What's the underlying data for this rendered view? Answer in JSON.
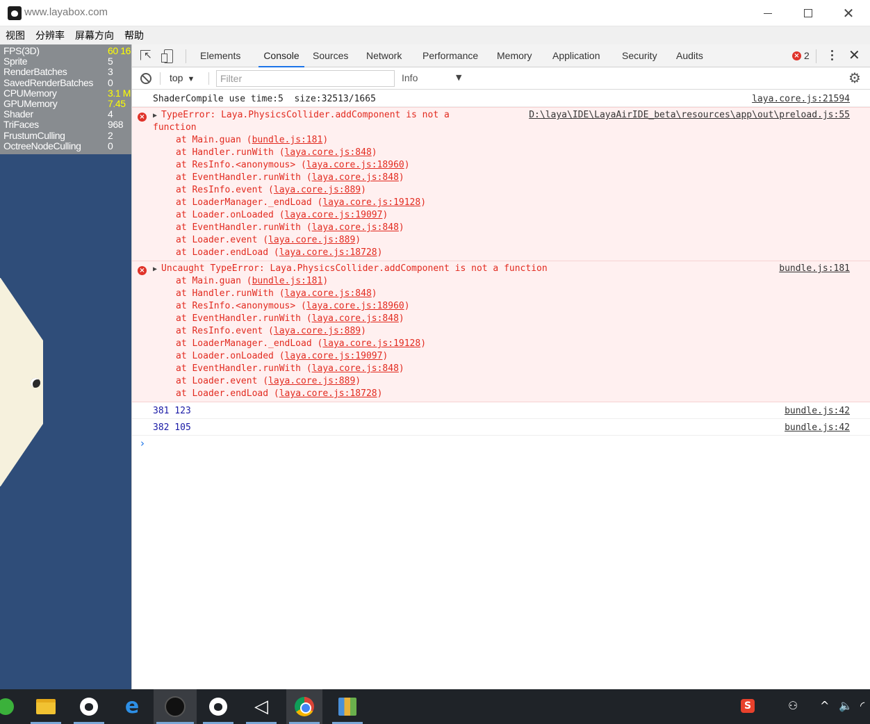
{
  "window": {
    "title": "www.layabox.com"
  },
  "menu": [
    "视图",
    "分辨率",
    "屏幕方向",
    "帮助"
  ],
  "stats": [
    {
      "label": "FPS(3D)",
      "value": "60 16",
      "warn": true
    },
    {
      "label": "Sprite",
      "value": "5",
      "warn": false
    },
    {
      "label": "RenderBatches",
      "value": "3",
      "warn": false
    },
    {
      "label": "SavedRenderBatches",
      "value": "0",
      "warn": false
    },
    {
      "label": "CPUMemory",
      "value": "3.1 M",
      "warn": true
    },
    {
      "label": "GPUMemory",
      "value": "7.45",
      "warn": true
    },
    {
      "label": "Shader",
      "value": "4",
      "warn": false
    },
    {
      "label": "TriFaces",
      "value": "968",
      "warn": false
    },
    {
      "label": "FrustumCulling",
      "value": "2",
      "warn": false
    },
    {
      "label": "OctreeNodeCulling",
      "value": "0",
      "warn": false
    }
  ],
  "devtools": {
    "tabs": [
      "Elements",
      "Console",
      "Sources",
      "Network",
      "Performance",
      "Memory",
      "Application",
      "Security",
      "Audits"
    ],
    "active_tab": "Console",
    "error_count": "2",
    "context": "top",
    "filter_placeholder": "Filter",
    "level": "Info"
  },
  "console": {
    "shader_msg": "ShaderCompile use time:5  size:32513/1665",
    "shader_src": "laya.core.js:21594",
    "error1": {
      "line1": "TypeError: Laya.PhysicsCollider.addComponent is not a",
      "line2": "function",
      "src": "D:\\laya\\IDE\\LayaAirIDE_beta\\resources\\app\\out\\preload.js:55"
    },
    "error2": {
      "line1": "Uncaught TypeError: Laya.PhysicsCollider.addComponent is not a function",
      "src": "bundle.js:181"
    },
    "stack": [
      {
        "fn": "at Main.guan",
        "loc": "bundle.js:181"
      },
      {
        "fn": "at Handler.runWith",
        "loc": "laya.core.js:848"
      },
      {
        "fn": "at ResInfo.<anonymous>",
        "loc": "laya.core.js:18960"
      },
      {
        "fn": "at EventHandler.runWith",
        "loc": "laya.core.js:848"
      },
      {
        "fn": "at ResInfo.event",
        "loc": "laya.core.js:889"
      },
      {
        "fn": "at LoaderManager._endLoad",
        "loc": "laya.core.js:19128"
      },
      {
        "fn": "at Loader.onLoaded",
        "loc": "laya.core.js:19097"
      },
      {
        "fn": "at EventHandler.runWith",
        "loc": "laya.core.js:848"
      },
      {
        "fn": "at Loader.event",
        "loc": "laya.core.js:889"
      },
      {
        "fn": "at Loader.endLoad",
        "loc": "laya.core.js:18728"
      }
    ],
    "logs": [
      {
        "text": "381 123",
        "src": "bundle.js:42"
      },
      {
        "text": "382 105",
        "src": "bundle.js:42"
      }
    ],
    "prompt": "›"
  },
  "taskbar": {
    "apps": [
      "browser-360-icon",
      "file-explorer-icon",
      "laya-ide-icon",
      "edge-icon",
      "layabox-icon",
      "laya-ide-2-icon",
      "unity-icon",
      "chrome-icon",
      "winrar-icon"
    ],
    "tray_sogou": "S"
  }
}
